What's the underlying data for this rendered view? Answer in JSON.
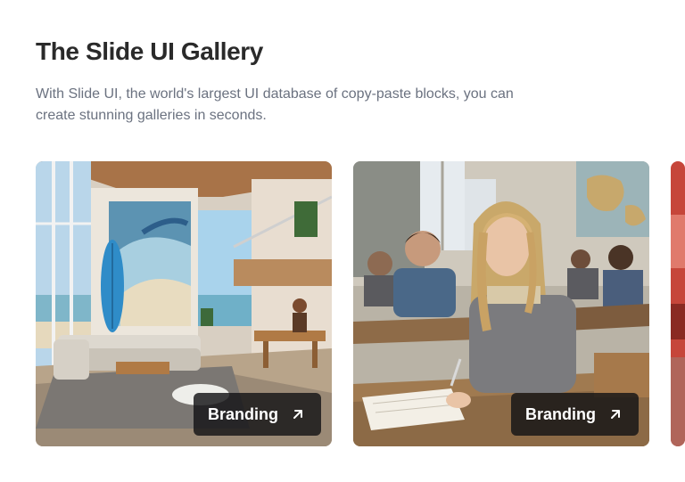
{
  "header": {
    "title": "The Slide UI Gallery",
    "subtitle": "With Slide UI, the world's largest UI database of copy-paste blocks, you can create stunning galleries in seconds."
  },
  "gallery": {
    "cards": [
      {
        "image": "beach-house-living-room",
        "badge_label": "Branding",
        "icon": "arrow-up-right-icon"
      },
      {
        "image": "classroom-student-writing",
        "badge_label": "Branding",
        "icon": "arrow-up-right-icon"
      },
      {
        "image": "partial-third-image"
      }
    ]
  }
}
